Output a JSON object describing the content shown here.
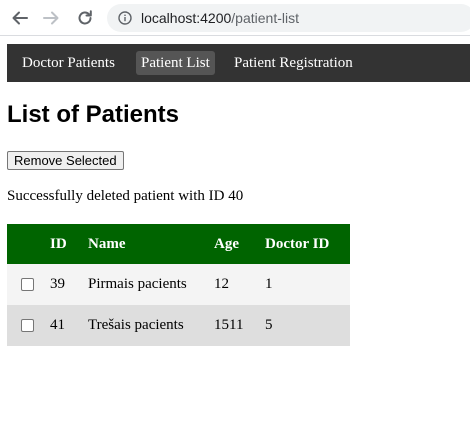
{
  "browser": {
    "url_host": "localhost:4200",
    "url_path": "/patient-list"
  },
  "nav": {
    "items": [
      {
        "label": "Doctor Patients",
        "active": false
      },
      {
        "label": "Patient List",
        "active": true
      },
      {
        "label": "Patient Registration",
        "active": false
      }
    ]
  },
  "page": {
    "title": "List of Patients",
    "remove_button_label": "Remove Selected",
    "status_message": "Successfully deleted patient with ID 40"
  },
  "table": {
    "headers": [
      "",
      "ID",
      "Name",
      "Age",
      "Doctor ID"
    ],
    "rows": [
      {
        "checked": false,
        "id": "39",
        "name": "Pirmais pacients",
        "age": "12",
        "doctor_id": "1"
      },
      {
        "checked": false,
        "id": "41",
        "name": "Trešais pacients",
        "age": "1511",
        "doctor_id": "5"
      }
    ]
  },
  "colors": {
    "navbar_bg": "#333333",
    "active_nav_bg": "#555555",
    "table_header_bg": "#006400",
    "row_odd_bg": "#f4f4f4",
    "row_even_bg": "#dedede"
  }
}
